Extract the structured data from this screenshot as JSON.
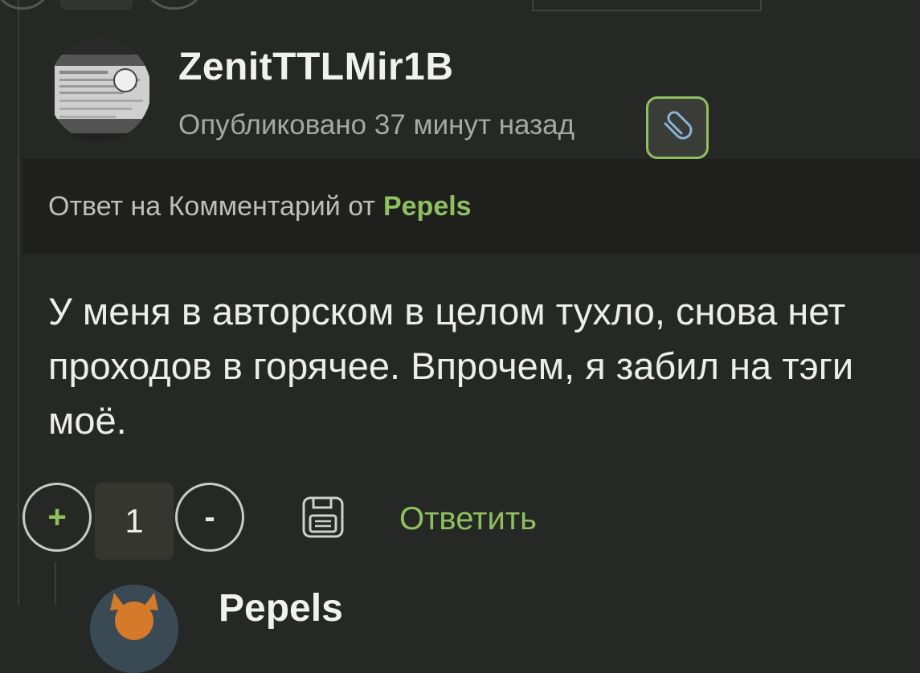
{
  "comment": {
    "username": "ZenitTTLMir1B",
    "published": "Опубликовано 37 минут назад",
    "reply_to_prefix": "Ответ на Комментарий от",
    "reply_to_author": "Pepels",
    "text": "У меня в авторском в целом тухло, снова нет проходов в горячее. Впрочем, я забил на тэги моё.",
    "rating": "1",
    "plus_label": "+",
    "minus_label": "-",
    "reply_label": "Ответить"
  },
  "next_comment": {
    "username_partial": "Pepels"
  },
  "colors": {
    "background": "#262825",
    "accent": "#8ec05f",
    "banner": "#1f201e"
  },
  "icons": [
    "attachment-icon",
    "save-icon",
    "plus-icon",
    "minus-icon"
  ]
}
